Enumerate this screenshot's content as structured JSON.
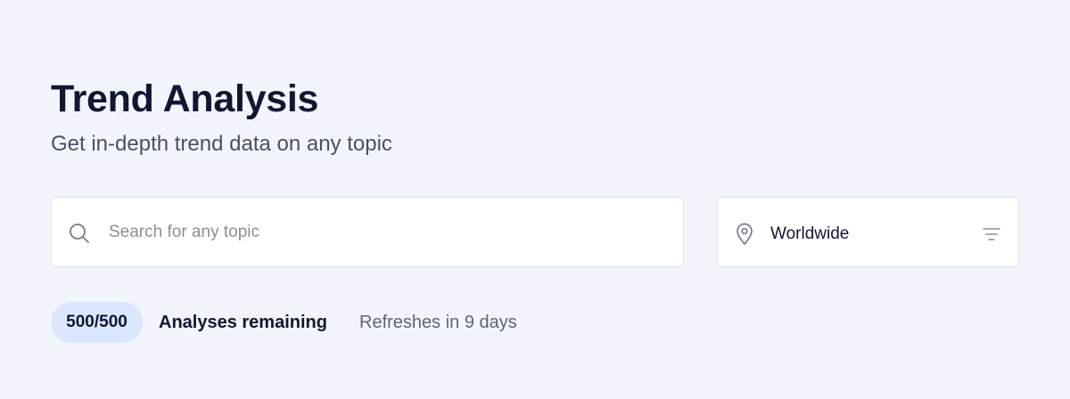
{
  "header": {
    "title": "Trend Analysis",
    "subtitle": "Get in-depth trend data on any topic"
  },
  "search": {
    "placeholder": "Search for any topic",
    "value": "",
    "icon": "search-icon"
  },
  "location": {
    "selected": "Worldwide",
    "icon": "location-pin-icon",
    "filter_icon": "filter-icon"
  },
  "quota": {
    "badge": "500/500",
    "label": "Analyses remaining",
    "refresh_note": "Refreshes in 9 days"
  },
  "colors": {
    "background": "#f2f6fc",
    "badge_background": "#dbe7ff",
    "text_primary": "#111633",
    "text_muted": "#5f6473"
  }
}
